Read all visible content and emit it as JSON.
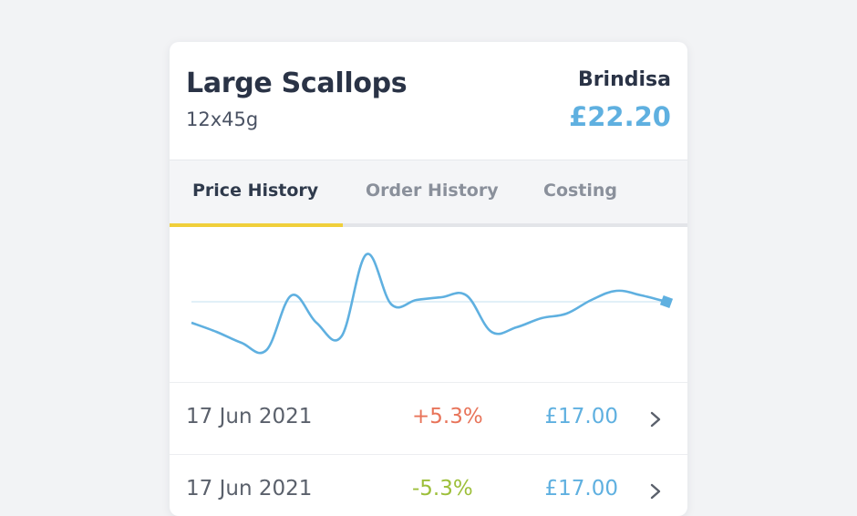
{
  "product": {
    "name": "Large Scallops",
    "pack": "12x45g",
    "supplier": "Brindisa",
    "price": "£22.20"
  },
  "tabs": [
    {
      "label": "Price History",
      "active": true
    },
    {
      "label": "Order History",
      "active": false
    },
    {
      "label": "Costing",
      "active": false
    }
  ],
  "colors": {
    "accent_blue": "#5fb0e0",
    "tab_underline": "#f0cf3a",
    "increase": "#e8745a",
    "decrease": "#9dbf3a"
  },
  "icons": {
    "row_chevron": "chevron-right-icon"
  },
  "chart_data": {
    "type": "line",
    "series": [
      {
        "values": [
          50,
          49,
          47.8,
          47,
          53,
          50,
          48.5,
          57.5,
          52,
          52.5,
          52.8,
          53,
          49,
          49.5,
          50.5,
          51,
          52.5,
          53.5,
          53,
          52.3
        ]
      }
    ],
    "reference_line": 52.3,
    "ylim": [
      45,
      59
    ],
    "grid": false,
    "smooth": true,
    "end_marker": "square"
  },
  "price_history": [
    {
      "date": "17 Jun 2021",
      "change": "+5.3%",
      "direction": "up",
      "amount": "£17.00"
    },
    {
      "date": "17 Jun 2021",
      "change": "-5.3%",
      "direction": "down",
      "amount": "£17.00"
    }
  ]
}
